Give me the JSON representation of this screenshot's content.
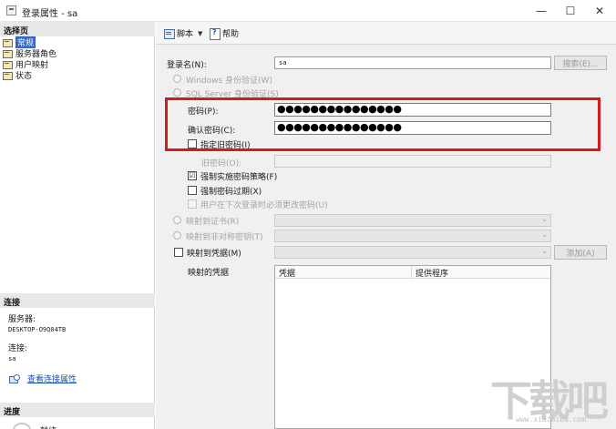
{
  "window": {
    "title": "登录属性 - sa",
    "minimize_glyph": "—",
    "maximize_glyph": "☐",
    "close_glyph": "✕"
  },
  "left_pane": {
    "select_page_header": "选择页",
    "nav_items": [
      {
        "label": "常规",
        "icon": "page-icon",
        "selected": true
      },
      {
        "label": "服务器角色",
        "icon": "page-icon",
        "selected": false
      },
      {
        "label": "用户映射",
        "icon": "page-icon",
        "selected": false
      },
      {
        "label": "状态",
        "icon": "page-icon",
        "selected": false
      }
    ],
    "connection_header": "连接",
    "server_label": "服务器:",
    "server_value": "DESKTOP-O9Q04TB",
    "connection_label": "连接:",
    "connection_value": "sa",
    "view_connection_link": "查看连接属性",
    "progress_header": "进度",
    "progress_status": "就绪"
  },
  "toolbar": {
    "script_label": "脚本",
    "script_caret": "▼",
    "help_label": "帮助"
  },
  "form": {
    "login_name_label": "登录名(N):",
    "login_name_value": "sa",
    "search_button": "搜索(E)...",
    "windows_auth_label": "Windows 身份验证(W)",
    "sql_auth_label": "SQL Server 身份验证(S)",
    "password_label": "密码(P):",
    "password_value": "●●●●●●●●●●●●●●●",
    "confirm_password_label": "确认密码(C):",
    "confirm_password_value": "●●●●●●●●●●●●●●●",
    "specify_old_password_label": "指定旧密码(I)",
    "old_password_label": "旧密码(O):",
    "enforce_policy_label": "强制实施密码策略(F)",
    "enforce_policy_checked": "☑",
    "enforce_expiration_label": "强制密码过期(X)",
    "must_change_label": "用户在下次登录时必须更改密码(U)",
    "map_certificate_label": "映射到证书(R)",
    "map_asymmetric_key_label": "映射到非对称密钥(T)",
    "map_credential_label": "映射到凭据(M)",
    "add_button": "添加(A)",
    "mapped_credentials_label": "映射的凭据",
    "grid_headers": [
      "凭据",
      "提供程序"
    ],
    "combo_arrow": "⌄"
  },
  "watermark": {
    "text": "下载吧",
    "sub": "www.xiazaiba.com"
  },
  "colors": {
    "highlight_border": "#d31c1c",
    "selected_nav": "#3465c7",
    "link": "#1a4fa8"
  }
}
